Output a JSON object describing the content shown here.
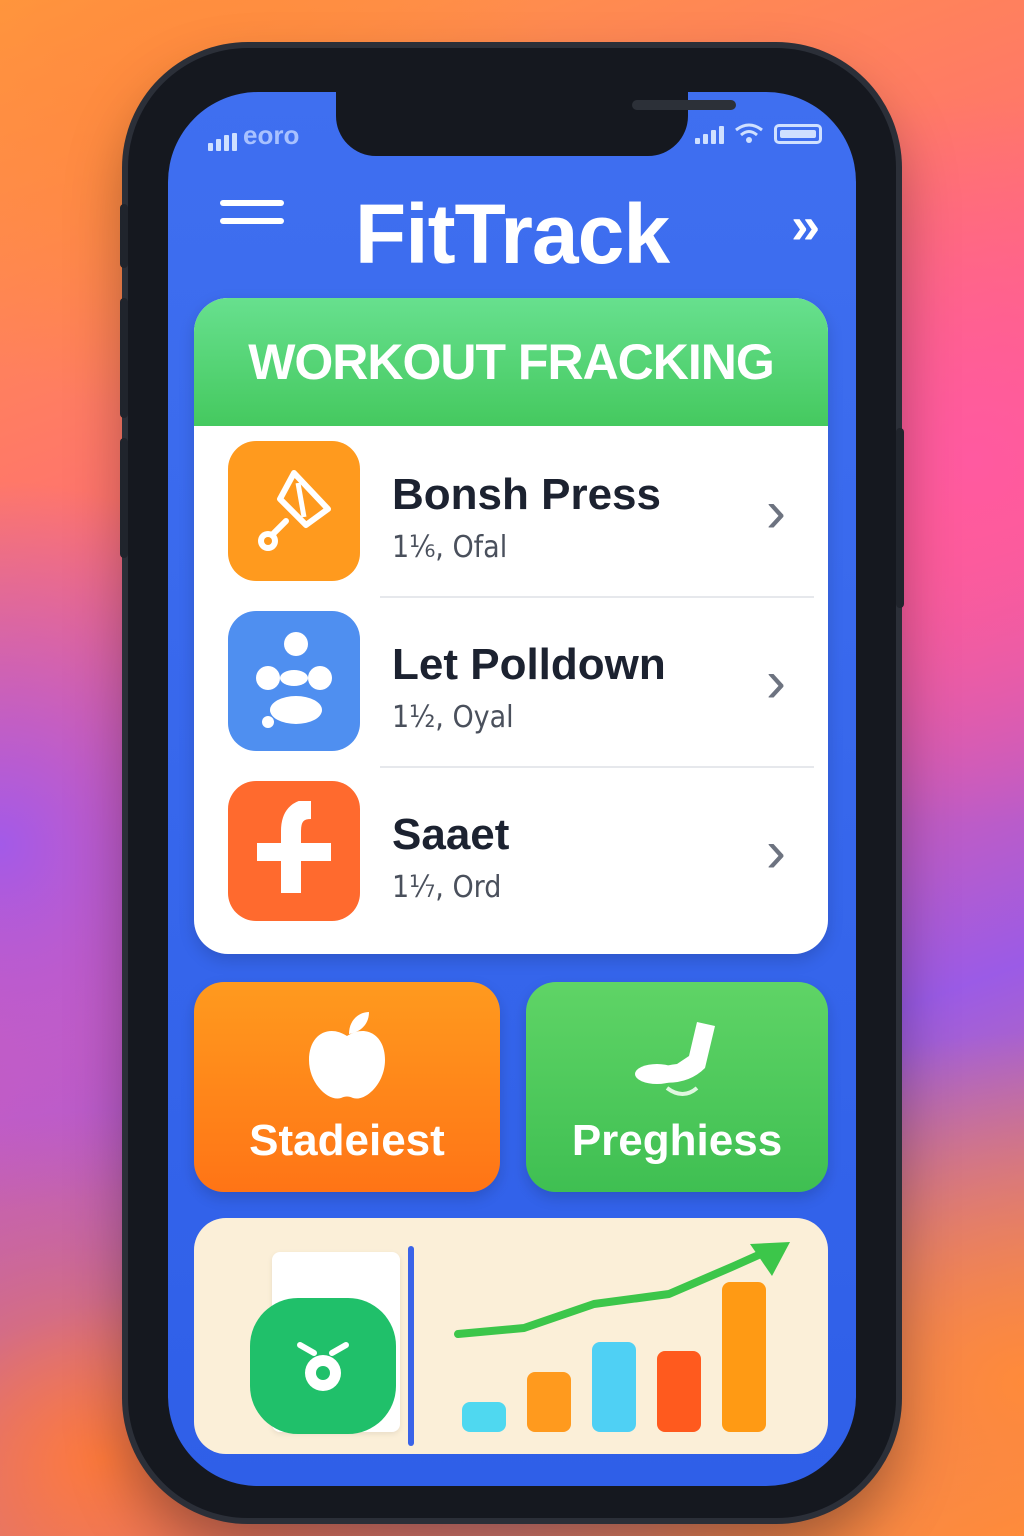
{
  "status_bar": {
    "carrier": "eoro"
  },
  "header": {
    "title": "FitTrack"
  },
  "section": {
    "title": "WORKOUT FRACKING"
  },
  "workouts": [
    {
      "name": "Bonsh Press",
      "detail": "1⅟₆, Ofal",
      "icon": "pushpin-icon",
      "color": "#ff9a1e"
    },
    {
      "name": "Let Polldown",
      "detail": "1⅟₂, Oyal",
      "icon": "dumbbell-icon",
      "color": "#4f8ff0"
    },
    {
      "name": "Saaet",
      "detail": "1⅟₇, Ord",
      "icon": "plus-icon",
      "color": "#ff6a2e"
    }
  ],
  "tiles": [
    {
      "label": "Stadeiest",
      "icon": "apple-icon",
      "color": "#ff8c1a"
    },
    {
      "label": "Preghiess",
      "icon": "shoe-icon",
      "color": "#4dc85a"
    }
  ],
  "chart_data": {
    "type": "bar",
    "categories": [
      "1",
      "2",
      "3",
      "4",
      "5"
    ],
    "values": [
      1,
      2,
      3,
      2.7,
      5
    ],
    "colors": [
      "#4fd8f0",
      "#ff9a1e",
      "#4fd0f4",
      "#ff5a1e",
      "#ff9a14"
    ],
    "trend_line": "increasing",
    "title": "",
    "xlabel": "",
    "ylabel": ""
  }
}
